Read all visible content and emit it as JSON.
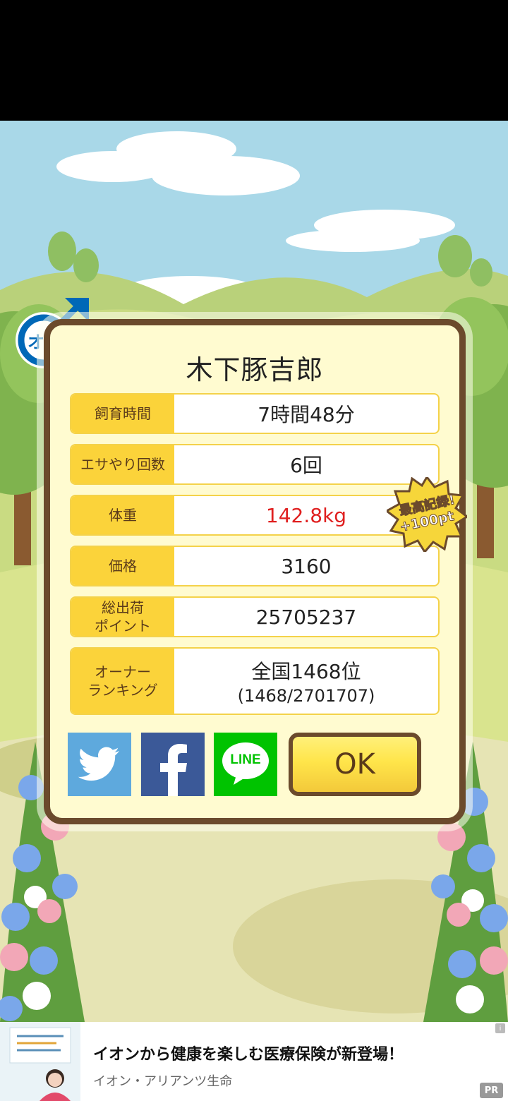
{
  "pig_name": "木下豚吉郎",
  "gender": {
    "icon": "male-symbol-icon",
    "label": "オス",
    "color": "#0068b7"
  },
  "stats": {
    "breeding_time": {
      "label": "飼育時間",
      "value": "7時間48分"
    },
    "feed_count": {
      "label": "エサやり回数",
      "value": "6回"
    },
    "weight": {
      "label": "体重",
      "value": "142.8kg",
      "color": "#e02020"
    },
    "price": {
      "label": "価格",
      "value": "3160"
    },
    "total_points": {
      "label_line1": "総出荷",
      "label_line2": "ポイント",
      "value": "25705237"
    },
    "ranking": {
      "label_line1": "オーナー",
      "label_line2": "ランキング",
      "value_line1": "全国1468位",
      "value_line2": "(1468/2701707)"
    }
  },
  "record_badge": {
    "line1": "最高記録!",
    "line2": "+100pt"
  },
  "share": [
    {
      "name": "twitter",
      "icon": "twitter-bird-icon",
      "color": "#5ea9dd"
    },
    {
      "name": "facebook",
      "icon": "facebook-f-icon",
      "color": "#3b5998"
    },
    {
      "name": "line",
      "icon": "line-logo-icon",
      "label": "LINE",
      "color": "#00c300"
    }
  ],
  "ok_button": {
    "label": "OK"
  },
  "ad": {
    "title": "イオンから健康を楽しむ医療保険が新登場！",
    "sponsor": "イオン・アリアンツ生命",
    "pr_label": "PR",
    "info_glyph": "i"
  }
}
